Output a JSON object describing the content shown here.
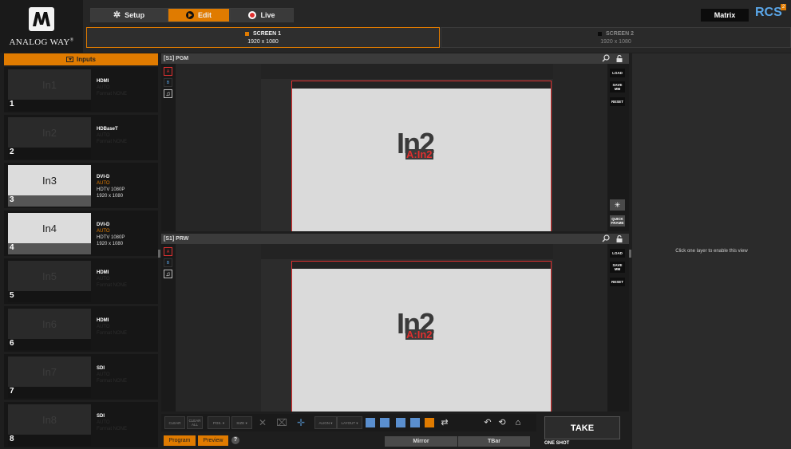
{
  "header": {
    "brand": "ANALOG WAY",
    "brand_mark": "®",
    "modes": {
      "setup": "Setup",
      "edit": "Edit",
      "live": "Live"
    },
    "matrix_label": "Matrix",
    "rcs_label": "RCS",
    "rcs_badge": "2"
  },
  "screens": [
    {
      "label": "SCREEN 1",
      "resolution": "1920 x 1080"
    },
    {
      "label": "SCREEN 2",
      "resolution": "1920 x 1080"
    }
  ],
  "inputs_panel": {
    "title": "Inputs"
  },
  "inputs": [
    {
      "name": "In1",
      "number": "1",
      "type": "HDMI",
      "mode": "AUTO",
      "format": "Format NONE",
      "resolution": ""
    },
    {
      "name": "In2",
      "number": "2",
      "type": "HDBaseT",
      "mode": "AUTO",
      "format": "Format NONE",
      "resolution": ""
    },
    {
      "name": "In3",
      "number": "3",
      "type": "DVI-D",
      "mode": "AUTO",
      "format": "HDTV 1080P",
      "resolution": "1920 x 1080"
    },
    {
      "name": "In4",
      "number": "4",
      "type": "DVI-D",
      "mode": "AUTO",
      "format": "HDTV 1080P",
      "resolution": "1920 x 1080"
    },
    {
      "name": "In5",
      "number": "5",
      "type": "HDMI",
      "mode": "AUTO",
      "format": "Format NONE",
      "resolution": ""
    },
    {
      "name": "In6",
      "number": "6",
      "type": "HDMI",
      "mode": "AUTO",
      "format": "Format NONE",
      "resolution": ""
    },
    {
      "name": "In7",
      "number": "7",
      "type": "SDI",
      "mode": "AUTO",
      "format": "Format NONE",
      "resolution": ""
    },
    {
      "name": "In8",
      "number": "8",
      "type": "SDI",
      "mode": "AUTO",
      "format": "Format NONE",
      "resolution": ""
    }
  ],
  "pgm": {
    "title": "[S1] PGM",
    "side_buttons": {
      "a": "A",
      "b": "B"
    },
    "layer_name": "In2",
    "layer_tag": "A:In2",
    "actions": {
      "load": "LOAD",
      "save_mm_1": "SAVE",
      "save_mm_2": "MM",
      "reset": "RESET",
      "quick_frame_1": "QUICK",
      "quick_frame_2": "FRAME"
    }
  },
  "prw": {
    "title": "[S1] PRW",
    "side_buttons": {
      "a": "A",
      "b": "B"
    },
    "layer_name": "In2",
    "layer_tag": "A:In2",
    "actions": {
      "load": "LOAD",
      "save_mm_1": "SAVE",
      "save_mm_2": "MM",
      "reset": "RESET"
    }
  },
  "right_panel": {
    "message": "Click one layer to enable this view"
  },
  "toolbar": {
    "clear": "CLEAR",
    "clear_all_1": "CLEAR",
    "clear_all_2": "ALL",
    "pos": "POS. ▾",
    "size": "SIZE ▾",
    "align": "ALIGN ▾",
    "layout": "LAYOUT ▾"
  },
  "bottom": {
    "program": "Program",
    "preview": "Preview",
    "help": "?",
    "mirror": "Mirror",
    "tbar": "TBar",
    "take": "TAKE",
    "one_shot": "ONE SHOT"
  },
  "colors": {
    "accent": "#e07b00",
    "layer_border": "#e03030",
    "rcs_blue": "#5aa6e8"
  },
  "icons": [
    "gear-icon",
    "edit-icon",
    "live-icon",
    "search-icon",
    "lock-icon",
    "audio-icon",
    "brightness-icon"
  ]
}
